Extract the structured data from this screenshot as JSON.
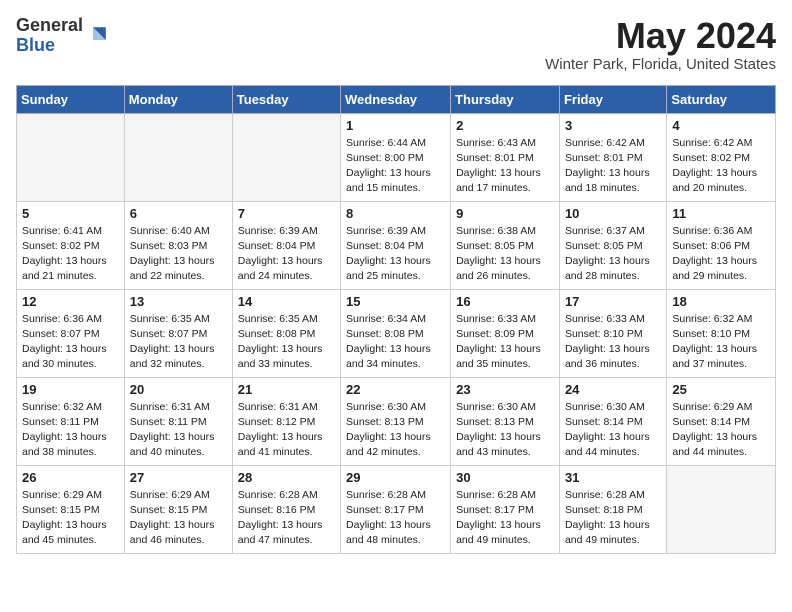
{
  "header": {
    "logo_general": "General",
    "logo_blue": "Blue",
    "month_year": "May 2024",
    "location": "Winter Park, Florida, United States"
  },
  "days_of_week": [
    "Sunday",
    "Monday",
    "Tuesday",
    "Wednesday",
    "Thursday",
    "Friday",
    "Saturday"
  ],
  "weeks": [
    [
      {
        "day": "",
        "info": ""
      },
      {
        "day": "",
        "info": ""
      },
      {
        "day": "",
        "info": ""
      },
      {
        "day": "1",
        "info": "Sunrise: 6:44 AM\nSunset: 8:00 PM\nDaylight: 13 hours\nand 15 minutes."
      },
      {
        "day": "2",
        "info": "Sunrise: 6:43 AM\nSunset: 8:01 PM\nDaylight: 13 hours\nand 17 minutes."
      },
      {
        "day": "3",
        "info": "Sunrise: 6:42 AM\nSunset: 8:01 PM\nDaylight: 13 hours\nand 18 minutes."
      },
      {
        "day": "4",
        "info": "Sunrise: 6:42 AM\nSunset: 8:02 PM\nDaylight: 13 hours\nand 20 minutes."
      }
    ],
    [
      {
        "day": "5",
        "info": "Sunrise: 6:41 AM\nSunset: 8:02 PM\nDaylight: 13 hours\nand 21 minutes."
      },
      {
        "day": "6",
        "info": "Sunrise: 6:40 AM\nSunset: 8:03 PM\nDaylight: 13 hours\nand 22 minutes."
      },
      {
        "day": "7",
        "info": "Sunrise: 6:39 AM\nSunset: 8:04 PM\nDaylight: 13 hours\nand 24 minutes."
      },
      {
        "day": "8",
        "info": "Sunrise: 6:39 AM\nSunset: 8:04 PM\nDaylight: 13 hours\nand 25 minutes."
      },
      {
        "day": "9",
        "info": "Sunrise: 6:38 AM\nSunset: 8:05 PM\nDaylight: 13 hours\nand 26 minutes."
      },
      {
        "day": "10",
        "info": "Sunrise: 6:37 AM\nSunset: 8:05 PM\nDaylight: 13 hours\nand 28 minutes."
      },
      {
        "day": "11",
        "info": "Sunrise: 6:36 AM\nSunset: 8:06 PM\nDaylight: 13 hours\nand 29 minutes."
      }
    ],
    [
      {
        "day": "12",
        "info": "Sunrise: 6:36 AM\nSunset: 8:07 PM\nDaylight: 13 hours\nand 30 minutes."
      },
      {
        "day": "13",
        "info": "Sunrise: 6:35 AM\nSunset: 8:07 PM\nDaylight: 13 hours\nand 32 minutes."
      },
      {
        "day": "14",
        "info": "Sunrise: 6:35 AM\nSunset: 8:08 PM\nDaylight: 13 hours\nand 33 minutes."
      },
      {
        "day": "15",
        "info": "Sunrise: 6:34 AM\nSunset: 8:08 PM\nDaylight: 13 hours\nand 34 minutes."
      },
      {
        "day": "16",
        "info": "Sunrise: 6:33 AM\nSunset: 8:09 PM\nDaylight: 13 hours\nand 35 minutes."
      },
      {
        "day": "17",
        "info": "Sunrise: 6:33 AM\nSunset: 8:10 PM\nDaylight: 13 hours\nand 36 minutes."
      },
      {
        "day": "18",
        "info": "Sunrise: 6:32 AM\nSunset: 8:10 PM\nDaylight: 13 hours\nand 37 minutes."
      }
    ],
    [
      {
        "day": "19",
        "info": "Sunrise: 6:32 AM\nSunset: 8:11 PM\nDaylight: 13 hours\nand 38 minutes."
      },
      {
        "day": "20",
        "info": "Sunrise: 6:31 AM\nSunset: 8:11 PM\nDaylight: 13 hours\nand 40 minutes."
      },
      {
        "day": "21",
        "info": "Sunrise: 6:31 AM\nSunset: 8:12 PM\nDaylight: 13 hours\nand 41 minutes."
      },
      {
        "day": "22",
        "info": "Sunrise: 6:30 AM\nSunset: 8:13 PM\nDaylight: 13 hours\nand 42 minutes."
      },
      {
        "day": "23",
        "info": "Sunrise: 6:30 AM\nSunset: 8:13 PM\nDaylight: 13 hours\nand 43 minutes."
      },
      {
        "day": "24",
        "info": "Sunrise: 6:30 AM\nSunset: 8:14 PM\nDaylight: 13 hours\nand 44 minutes."
      },
      {
        "day": "25",
        "info": "Sunrise: 6:29 AM\nSunset: 8:14 PM\nDaylight: 13 hours\nand 44 minutes."
      }
    ],
    [
      {
        "day": "26",
        "info": "Sunrise: 6:29 AM\nSunset: 8:15 PM\nDaylight: 13 hours\nand 45 minutes."
      },
      {
        "day": "27",
        "info": "Sunrise: 6:29 AM\nSunset: 8:15 PM\nDaylight: 13 hours\nand 46 minutes."
      },
      {
        "day": "28",
        "info": "Sunrise: 6:28 AM\nSunset: 8:16 PM\nDaylight: 13 hours\nand 47 minutes."
      },
      {
        "day": "29",
        "info": "Sunrise: 6:28 AM\nSunset: 8:17 PM\nDaylight: 13 hours\nand 48 minutes."
      },
      {
        "day": "30",
        "info": "Sunrise: 6:28 AM\nSunset: 8:17 PM\nDaylight: 13 hours\nand 49 minutes."
      },
      {
        "day": "31",
        "info": "Sunrise: 6:28 AM\nSunset: 8:18 PM\nDaylight: 13 hours\nand 49 minutes."
      },
      {
        "day": "",
        "info": ""
      }
    ]
  ]
}
